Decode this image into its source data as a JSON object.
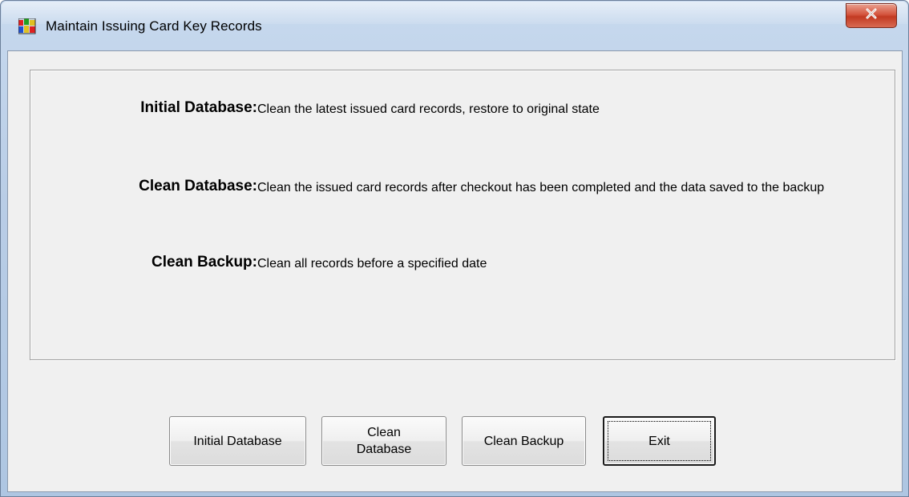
{
  "window": {
    "title": "Maintain Issuing Card Key Records",
    "icon": "app-windows-icon",
    "close_icon": "close-icon"
  },
  "descriptions": [
    {
      "label": "Initial Database:",
      "text": "Clean the latest issued card records, restore to original state"
    },
    {
      "label": "Clean Database:",
      "text": "Clean the issued card records after checkout has been completed and the data saved to the backup"
    },
    {
      "label": "Clean Backup:",
      "text": "Clean all records before a specified date"
    }
  ],
  "buttons": {
    "initial_database": "Initial Database",
    "clean_database_line1": "Clean",
    "clean_database_line2": "Database",
    "clean_backup": "Clean Backup",
    "exit": "Exit"
  },
  "colors": {
    "close_button": "#c8452c",
    "client_background": "#f0f0f0",
    "title_bar": "#bcd0e8"
  }
}
